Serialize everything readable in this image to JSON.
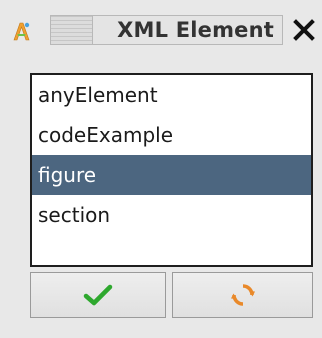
{
  "window": {
    "title": "XML Element"
  },
  "list": {
    "items": [
      {
        "label": "anyElement",
        "selected": false
      },
      {
        "label": "codeExample",
        "selected": false
      },
      {
        "label": "figure",
        "selected": true
      },
      {
        "label": "section",
        "selected": false
      }
    ]
  },
  "buttons": {
    "ok_icon": "checkmark-icon",
    "refresh_icon": "refresh-icon"
  },
  "colors": {
    "selection": "#4c6680",
    "check_green": "#2ea82e",
    "refresh_orange": "#e9892a"
  }
}
